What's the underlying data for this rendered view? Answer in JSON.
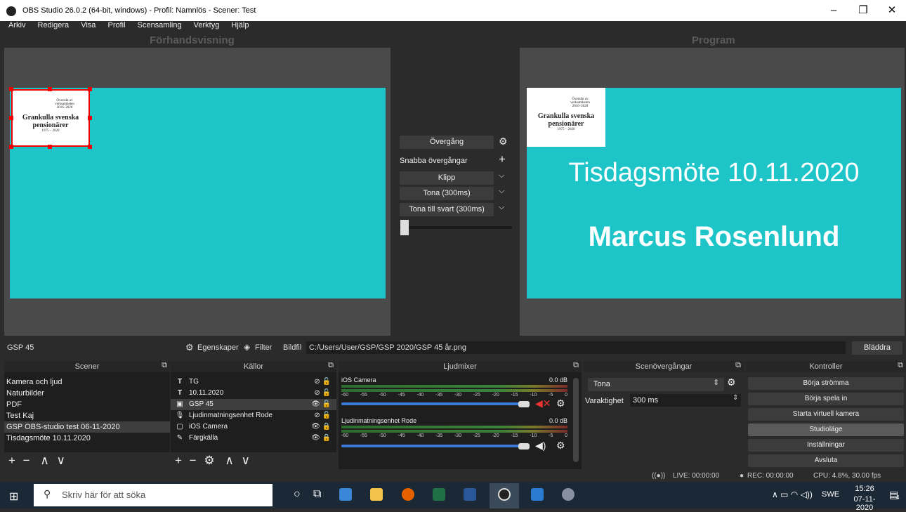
{
  "window": {
    "title": "OBS Studio 26.0.2 (64-bit, windows) - Profil: Namnlös - Scener: Test",
    "min": "–",
    "restore": "❐",
    "close": "✕"
  },
  "menu": [
    "Arkiv",
    "Redigera",
    "Visa",
    "Profil",
    "Scensamling",
    "Verktyg",
    "Hjälp"
  ],
  "preview": {
    "label": "Förhandsvisning",
    "logo_line1": "Översikt av",
    "logo_line2": "verksamheten",
    "logo_line3": "2016–2020",
    "logo_name1": "Grankulla svenska",
    "logo_name2": "pensionärer",
    "logo_years": "1975 – 2020"
  },
  "program": {
    "label": "Program",
    "line1": "Tisdagsmöte 10.11.2020",
    "line2": "Marcus Rosenlund"
  },
  "transition": {
    "button": "Övergång",
    "quick": "Snabba övergångar",
    "items": [
      "Klipp",
      "Tona (300ms)",
      "Tona till svart (300ms)"
    ]
  },
  "source_bar": {
    "name": "GSP 45",
    "properties": "Egenskaper",
    "filter": "Filter",
    "file_label": "Bildfil",
    "file_path": "C:/Users/User/GSP/GSP 2020/GSP 45 år.png",
    "browse": "Bläddra"
  },
  "scenes": {
    "title": "Scener",
    "items": [
      "Kamera och ljud",
      "Naturbilder",
      "PDF",
      "Test Kaj",
      "GSP OBS-studio test 06-11-2020",
      "Tisdagsmöte 10.11.2020"
    ],
    "selected": 4
  },
  "sources": {
    "title": "Källor",
    "items": [
      {
        "icon": "T",
        "name": "TG"
      },
      {
        "icon": "T",
        "name": "10.11.2020"
      },
      {
        "icon": "▣",
        "name": "GSP 45"
      },
      {
        "icon": "🎙",
        "name": "Ljudinmatningsenhet Rode"
      },
      {
        "icon": "▢",
        "name": "iOS Camera"
      },
      {
        "icon": "✎",
        "name": "Färgkälla"
      }
    ]
  },
  "mixer": {
    "title": "Ljudmixer",
    "channels": [
      {
        "name": "iOS Camera",
        "db": "0.0 dB",
        "level": 0.94,
        "muted": true
      },
      {
        "name": "Ljudinmatningsenhet Rode",
        "db": "0.0 dB",
        "level": 0.94,
        "muted": false
      }
    ],
    "ticks": [
      "-60",
      "-55",
      "-50",
      "-45",
      "-40",
      "-35",
      "-30",
      "-25",
      "-20",
      "-15",
      "-10",
      "-5",
      "0"
    ]
  },
  "scene_transitions": {
    "title": "Scenövergångar",
    "selected": "Tona",
    "duration_label": "Varaktighet",
    "duration": "300 ms"
  },
  "controls": {
    "title": "Kontroller",
    "buttons": [
      "Börja strömma",
      "Börja spela in",
      "Starta virtuell kamera",
      "Studioläge",
      "Inställningar",
      "Avsluta"
    ]
  },
  "status": {
    "live": "LIVE: 00:00:00",
    "rec": "REC: 00:00:00",
    "cpu": "CPU: 4.8%, 30.00 fps"
  },
  "taskbar": {
    "search": "Skriv här för att söka",
    "lang": "SWE",
    "time": "15:26",
    "date": "07-11-2020",
    "notif": "4"
  }
}
